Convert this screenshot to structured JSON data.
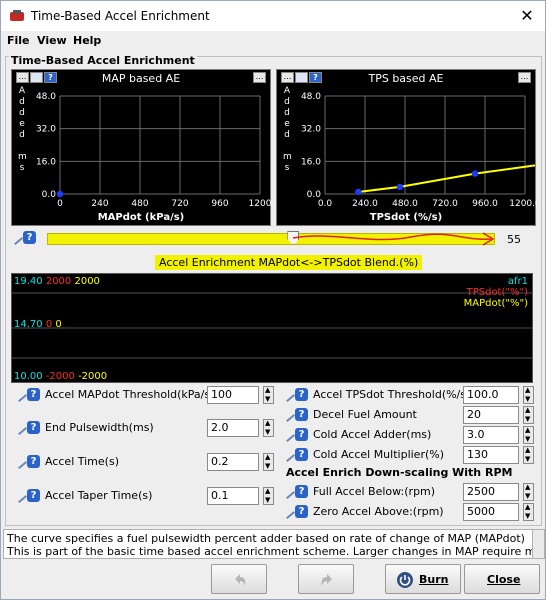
{
  "window": {
    "title": "Time-Based Accel Enrichment"
  },
  "menu": [
    "File",
    "View",
    "Help"
  ],
  "group_title": "Time-Based Accel Enrichment",
  "charts": [
    {
      "type": "line",
      "title": "MAP based AE",
      "ylabel": "Added ms",
      "xlabel": "MAPdot (kPa/s)",
      "y_ticks": [
        "48.0",
        "32.0",
        "16.0",
        "0.0"
      ],
      "x_ticks": [
        "0",
        "240",
        "480",
        "720",
        "960",
        "1200"
      ],
      "xlim": [
        0,
        1200
      ],
      "ylim": [
        0,
        48
      ],
      "x": [
        0
      ],
      "y": [
        0
      ],
      "line_color": "#ffff00",
      "point_color": "#1e3cff"
    },
    {
      "type": "line",
      "title": "TPS based AE",
      "ylabel": "Added ms",
      "xlabel": "TPSdot (%/s)",
      "y_ticks": [
        "48.0",
        "32.0",
        "16.0",
        "0.0"
      ],
      "x_ticks": [
        "0.0",
        "240.0",
        "480.0",
        "720.0",
        "960.0",
        "1200.0"
      ],
      "xlim": [
        0,
        1200
      ],
      "ylim": [
        0,
        48
      ],
      "x": [
        200,
        450,
        900,
        1300
      ],
      "y": [
        1,
        3.5,
        10,
        14
      ],
      "line_color": "#ffff00",
      "point_color": "#1e3cff"
    }
  ],
  "blend": {
    "value": "55",
    "fraction": 0.55,
    "caption": "Accel Enrichment MAPdot<->TPSdot Blend.(%)"
  },
  "gauge": {
    "top": [
      "19.40",
      "2000",
      "2000"
    ],
    "mid": [
      "14.70",
      "0",
      "0"
    ],
    "bottom": [
      "10.00",
      "-2000",
      "-2000"
    ],
    "legend": [
      "afr1",
      "TPSdot(\"%\")",
      "MAPdot(\"%\")"
    ],
    "colors": [
      "#00e5e5",
      "#ff2a2a",
      "#ffff00"
    ]
  },
  "left_fields": [
    {
      "label": "Accel MAPdot Threshold(kPa/s)",
      "value": "100"
    },
    {
      "label": "End Pulsewidth(ms)",
      "value": "2.0"
    },
    {
      "label": "Accel Time(s)",
      "value": "0.2"
    },
    {
      "label": "Accel Taper Time(s)",
      "value": "0.1"
    }
  ],
  "right_fields": [
    {
      "label": "Accel TPSdot Threshold(%/s)",
      "value": "100.0"
    },
    {
      "label": "Decel Fuel Amount",
      "value": "20"
    },
    {
      "label": "Cold Accel Adder(ms)",
      "value": "3.0"
    },
    {
      "label": "Cold Accel Multiplier(%)",
      "value": "130"
    }
  ],
  "rpm_section": "Accel Enrich Down-scaling With RPM",
  "rpm_fields": [
    {
      "label": "Full Accel Below:(rpm)",
      "value": "2500"
    },
    {
      "label": "Zero Accel Above:(rpm)",
      "value": "5000"
    }
  ],
  "description": [
    "The curve specifies a fuel pulsewidth percent adder based on rate of change of MAP (MAPdot)",
    "This is part of the basic time based accel enrichment scheme. Larger changes in MAP require more fuel"
  ],
  "buttons": {
    "burn": "Burn",
    "close": "Close"
  }
}
